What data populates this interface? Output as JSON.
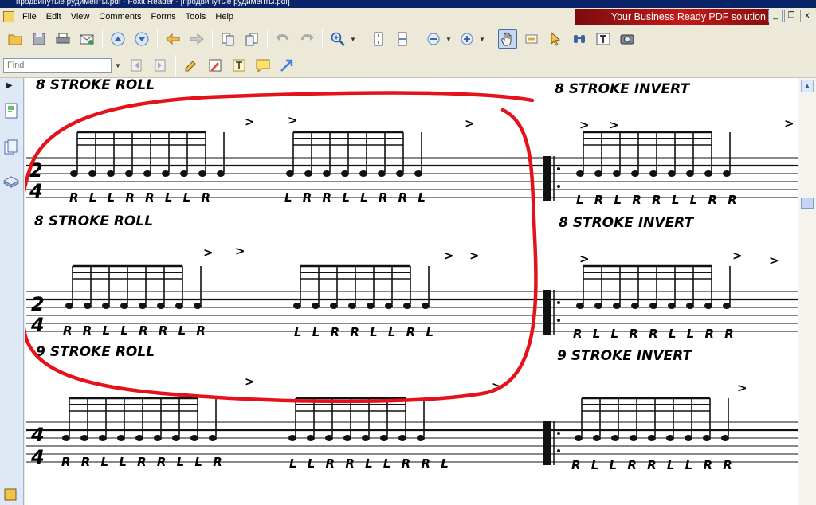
{
  "window": {
    "title": "продвинутые рудименты.pdf - Foxit Reader - [продвинутые рудименты.pdf]",
    "ad_text": "Your Business Ready PDF solution",
    "min": "_",
    "restore": "❐",
    "close": "x"
  },
  "menu": [
    "File",
    "Edit",
    "View",
    "Comments",
    "Forms",
    "Tools",
    "Help"
  ],
  "toolbar1": {
    "icons": [
      "open-icon",
      "save-icon",
      "print-icon",
      "email-icon",
      "page-up-icon",
      "page-down-icon",
      "back-icon",
      "forward-icon",
      "extract-pages-icon",
      "insert-pages-icon",
      "undo-icon",
      "redo-icon",
      "zoom-icon",
      "fit-page-icon",
      "fit-width-icon",
      "zoom-out-icon",
      "zoom-in-icon",
      "hand-tool-icon",
      "select-text-icon",
      "select-annotation-icon",
      "find-icon",
      "typewriter-icon",
      "snapshot-icon"
    ]
  },
  "toolbar2": {
    "find_placeholder": "Find",
    "icons": [
      "find-prev-icon",
      "find-next-icon",
      "note-icon",
      "pencil-icon",
      "textbox-icon",
      "comment-icon",
      "arrow-tool-icon"
    ]
  },
  "document": {
    "headings": [
      "8  STROKE  ROLL",
      "8  STROKE  INVERT",
      "8  STROKE  ROLL",
      "8  STROKE  INVERT",
      "9  STROKE  ROLL",
      "9  STROKE  INVERT"
    ],
    "time_signature": {
      "top": "2",
      "bottom": "4",
      "top3": "4"
    },
    "stickings": [
      "R L L R R L L R",
      "L R R L L R R L",
      "L R L R R L L R R",
      "R R L L R R L R",
      "L L R R L L R L",
      "R L L R R L L R R",
      "R R L L R R L L R",
      "L L R R L L R R L",
      "R L L R R L L R R"
    ],
    "accent": ">"
  }
}
